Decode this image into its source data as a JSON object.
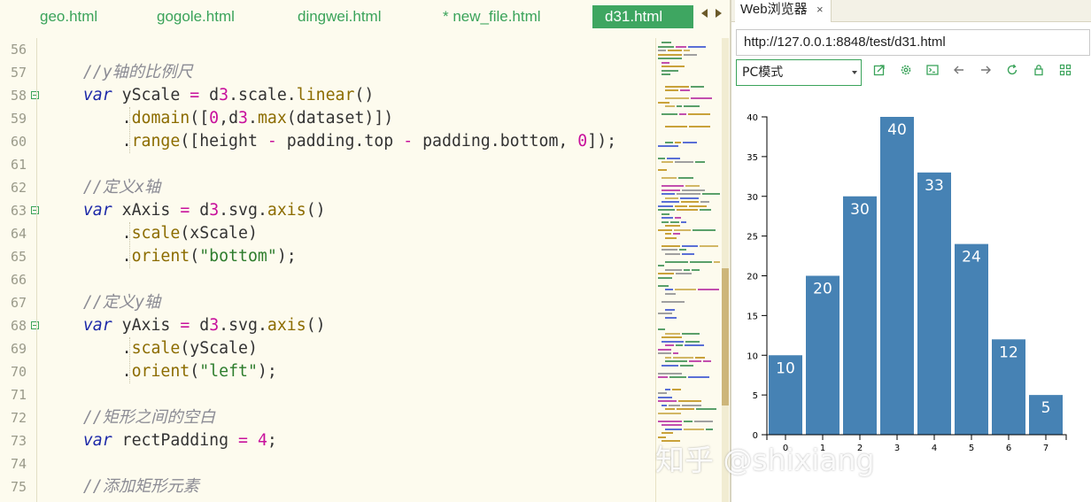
{
  "editor": {
    "tabs": [
      {
        "label": "geo.html",
        "active": false
      },
      {
        "label": "gogole.html",
        "active": false
      },
      {
        "label": "dingwei.html",
        "active": false
      },
      {
        "label": "* new_file.html",
        "active": false
      },
      {
        "label": "d31.html",
        "active": true
      }
    ],
    "line_numbers": [
      "56",
      "57",
      "58",
      "59",
      "60",
      "61",
      "62",
      "63",
      "64",
      "65",
      "66",
      "67",
      "68",
      "69",
      "70",
      "71",
      "72",
      "73",
      "74",
      "75"
    ],
    "code_lines": [
      "",
      "    //y轴的比例尺",
      "    var yScale = d3.scale.linear()",
      "        .domain([0,d3.max(dataset)])",
      "        .range([height - padding.top - padding.bottom, 0]);",
      "",
      "    //定义x轴",
      "    var xAxis = d3.svg.axis()",
      "        .scale(xScale)",
      "        .orient(\"bottom\");",
      "",
      "    //定义y轴",
      "    var yAxis = d3.svg.axis()",
      "        .scale(yScale)",
      "        .orient(\"left\");",
      "",
      "    //矩形之间的空白",
      "    var rectPadding = 4;",
      "",
      "    //添加矩形元素"
    ]
  },
  "browser": {
    "tab_title": "Web浏览器",
    "tab_close": "×",
    "url": "http://127.0.0.1:8848/test/d31.html",
    "mode_select": "PC模式",
    "toolbar_icons": [
      "external-link-icon",
      "gear-icon",
      "console-icon",
      "back-arrow-icon",
      "forward-arrow-icon",
      "reload-icon",
      "lock-icon",
      "grid-icon"
    ],
    "watermark": "知乎 @shixiang"
  },
  "colors": {
    "bar": "#4682b4",
    "accent": "#3ea661",
    "editor_bg": "#fdfbee"
  },
  "chart_data": {
    "type": "bar",
    "categories": [
      "0",
      "1",
      "2",
      "3",
      "4",
      "5",
      "6",
      "7"
    ],
    "values": [
      10,
      20,
      30,
      40,
      33,
      24,
      12,
      5
    ],
    "data_labels": [
      "10",
      "20",
      "30",
      "40",
      "33",
      "24",
      "12",
      "5"
    ],
    "y_ticks": [
      "0",
      "5",
      "10",
      "15",
      "20",
      "25",
      "30",
      "35",
      "40"
    ],
    "ylim": [
      0,
      40
    ],
    "title": "",
    "xlabel": "",
    "ylabel": "",
    "grid": false,
    "legend": "none"
  }
}
